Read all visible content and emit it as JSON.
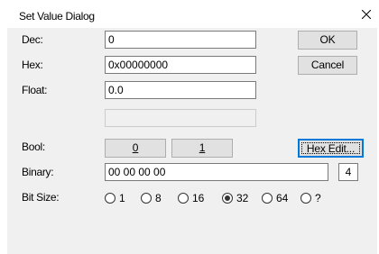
{
  "window": {
    "title": "Set Value Dialog"
  },
  "labels": {
    "dec": "Dec:",
    "hex": "Hex:",
    "float": "Float:",
    "bool": "Bool:",
    "binary": "Binary:",
    "bitsize": "Bit Size:"
  },
  "fields": {
    "dec": "0",
    "hex": "0x00000000",
    "float": "0.0",
    "binary": "00 00 00 00",
    "byte_count": "4"
  },
  "buttons": {
    "ok": "OK",
    "cancel": "Cancel",
    "bool_false": "0",
    "bool_true": "1",
    "hex_edit": "Hex Edit..."
  },
  "bit_size": {
    "options": [
      "1",
      "8",
      "16",
      "32",
      "64",
      "?"
    ],
    "selected": "32"
  }
}
